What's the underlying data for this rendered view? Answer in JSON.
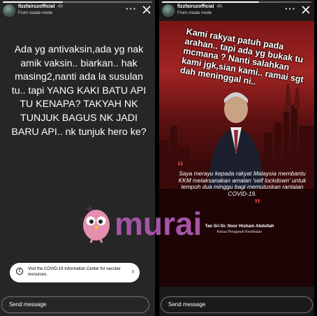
{
  "left_story": {
    "username": "fizzfairuzofficial",
    "time": "4h",
    "subtitle": "From create mode",
    "progress": 0.4,
    "text": "Ada yg antivaksin,ada yg nak amik vaksin.. biarkan.. hak masing2,nanti ada la susulan tu.. tapi YANG KAKI BATU API TU KENAPA? TAKYAH NK TUNJUK BAGUS NK JADI BARU API.. nk tunjuk hero ke?",
    "info_sticker": "Visit the COVID-19 Information Center for vaccine resources.",
    "send_placeholder": "Send message"
  },
  "right_story": {
    "username": "fizzfairuzofficial",
    "time": "4h",
    "subtitle": "From create mode",
    "progress": 0.65,
    "overlay_text": "Kami rakyat patuh pada arahan.. tapi ada yg bukak tu mcmana ? Nanti salahkan kami jgk,sian kami.. ramai sgt dah meninggal ni..",
    "quote": "Saya merayu kepada rakyat Malaysia membantu KKM melaksanakan amalan 'self lockdown' untuk tempoh dua minggu bagi memutuskan rantaian COVID-19.",
    "speaker_name": "Tan Sri Dr. Noor Hisham Abdullah",
    "speaker_role": "Ketua Pengarah Kesihatan",
    "send_placeholder": "Send message"
  },
  "watermark": {
    "text": "murai",
    "color": "#a455a8"
  },
  "icons": [
    "more-icon",
    "close-icon",
    "info-icon",
    "chevron-right-icon",
    "bird-logo-icon"
  ]
}
